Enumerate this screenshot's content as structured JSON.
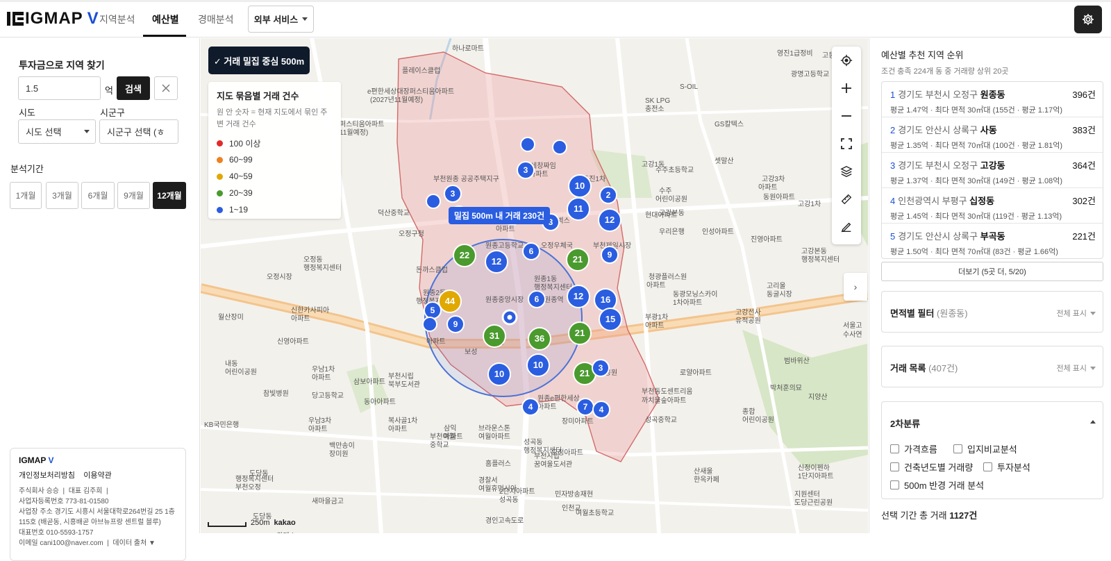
{
  "header": {
    "logo_main": "IGMAP",
    "logo_v": "V",
    "tabs": [
      {
        "label": "지역분석",
        "active": false
      },
      {
        "label": "예산별",
        "active": true
      },
      {
        "label": "경매분석",
        "active": false
      }
    ],
    "external_label": "외부 서비스"
  },
  "left": {
    "search_title": "투자금으로 지역 찾기",
    "amount_value": "1.5",
    "amount_unit": "억",
    "search_button": "검색",
    "clear_icon": "close-icon",
    "sido_label": "시도",
    "sigungu_label": "시군구",
    "sido_select": "시도 선택",
    "sigungu_select": "시군구 선택 (ㅎ",
    "period_label": "분석기간",
    "periods": [
      {
        "label": "1개월",
        "active": false
      },
      {
        "label": "3개월",
        "active": false
      },
      {
        "label": "6개월",
        "active": false
      },
      {
        "label": "9개월",
        "active": false
      },
      {
        "label": "12개월",
        "active": true
      }
    ],
    "footer": {
      "brand": "IGMAP",
      "brand_v": "V",
      "privacy": "개인정보처리방침",
      "terms": "이용약관",
      "company": "주식회사 승승",
      "ceo": "대표 김주희",
      "bizno": "사업자등록번호 773-81-01580",
      "address": "사업장 주소 경기도 시흥시 서울대학로264번길 25 1층 115호 (배곧동, 시흥배곧 아브뉴프랑 센트럴 블루)",
      "phone": "대표번호 010-5593-1757",
      "email": "이메일 cani100@naver.com",
      "data_source": "데이터 출처"
    }
  },
  "map": {
    "chip_label": "✓ 거래 밀집 중심 500m",
    "legend_title": "지도 묶음별 거래 건수",
    "legend_desc": "원 안 숫자 = 현재 지도에서 묶인 주변 거래 건수",
    "legend": [
      {
        "label": "100 이상",
        "color": "#e02b2b"
      },
      {
        "label": "60~99",
        "color": "#f08020"
      },
      {
        "label": "40~59",
        "color": "#e0a800"
      },
      {
        "label": "20~39",
        "color": "#4a9a2e"
      },
      {
        "label": "1~19",
        "color": "#2a5de0"
      }
    ],
    "dense_label": "밀집 500m 내 거래 230건",
    "scale_label": "250m",
    "provider": "kakao",
    "place_labels": [
      "하나로마트",
      "플레이스클럽",
      "e편한세상대장퍼스티움아파트",
      "(2027년11월예정)",
      "퍼스티움아파트",
      "11월예정)",
      "영진1급정비",
      "고등학교",
      "광명고등학교",
      "S-OIL",
      "SK LPG",
      "충전소",
      "GS칼텍스",
      "고강1동",
      "세창짜임",
      "아파트",
      "부천원종 공공주택지구",
      "동진1차",
      "수주",
      "어린이공원",
      "수주초등학교",
      "셋말산",
      "고강3차",
      "아파트",
      "동원아파트",
      "고강1차",
      "고강본동",
      "현대아파트",
      "원종주공",
      "아파트",
      "스타벅스",
      "덕산중학교",
      "오정구청",
      "원종고등학교",
      "오정우체국",
      "오정동",
      "행정복지센터",
      "우리은행",
      "인성아파트",
      "진영아파트",
      "고강본동",
      "행정복지센터",
      "돈까스클럽",
      "오정시장",
      "원종2동",
      "행정복지센터",
      "원종1동",
      "행정복지센터",
      "원종중앙시장",
      "원종역",
      "부천제일시장",
      "청광플러스원",
      "아파트",
      "동광모닝스카이",
      "1차아파트",
      "고리울",
      "동굴시장",
      "신한카사피아",
      "아파트",
      "부광1차",
      "아파트",
      "고강선사",
      "유적공원",
      "서울고",
      "수사연",
      "원종근린공원",
      "신영아파트",
      "범바위산",
      "내동",
      "어린이공원",
      "우남1차",
      "아파트",
      "삼보아파트",
      "부천시립",
      "북부도서관",
      "로얄아파트",
      "참빛병원",
      "부천동도센트리움",
      "까치울숲아파트",
      "지양산",
      "당고등학교",
      "동아아파트",
      "원종e편한세상",
      "아파트",
      "박처훈의묘",
      "종합",
      "어린이공원",
      "성곡중학교",
      "KB국민은행",
      "우남3차",
      "아파트",
      "복사골1차",
      "아파트",
      "장미아파트",
      "부천여월",
      "중학교",
      "브라운스톤",
      "여월아파트",
      "부천시립",
      "꿈여울도서관",
      "오정아파트",
      "성곡동",
      "행정복지센터",
      "백만송이",
      "장미원",
      "홈플러스",
      "산새울",
      "한옥카페",
      "신정이펜하",
      "1단지아파트",
      "인천교",
      "도당동",
      "행정복지센터",
      "부천오정",
      "경찰서",
      "여월휴먼시아",
      "2단지아파트",
      "성곡동",
      "민자방송재현",
      "지원센터",
      "도당근린공원",
      "새마을금고",
      "도당동",
      "GS칼텍스",
      "여월초등학교",
      "경인고속도로",
      "월산장미",
      "아파트",
      "보성",
      "120",
      "삼익",
      "아파트"
    ]
  },
  "right": {
    "title": "예산별 추천 지역 순위",
    "subtitle": "조건 충족 224개 동 중 거래량 상위 20곳",
    "ranks": [
      {
        "num": "1",
        "region": "경기도 부천시 오정구",
        "dong": "원종동",
        "count": "396건",
        "detail": "평균 1.47억 · 최다 면적 30㎡대 (155건 · 평균 1.17억)"
      },
      {
        "num": "2",
        "region": "경기도 안산시 상록구",
        "dong": "사동",
        "count": "383건",
        "detail": "평균 1.35억 · 최다 면적 70㎡대 (100건 · 평균 1.81억)"
      },
      {
        "num": "3",
        "region": "경기도 부천시 오정구",
        "dong": "고강동",
        "count": "364건",
        "detail": "평균 1.37억 · 최다 면적 30㎡대 (149건 · 평균 1.08억)"
      },
      {
        "num": "4",
        "region": "인천광역시 부평구",
        "dong": "십정동",
        "count": "302건",
        "detail": "평균 1.45억 · 최다 면적 30㎡대 (119건 · 평균 1.13억)"
      },
      {
        "num": "5",
        "region": "경기도 안산시 상록구",
        "dong": "부곡동",
        "count": "221건",
        "detail": "평균 1.50억 · 최다 면적 70㎡대 (83건 · 평균 1.66억)"
      }
    ],
    "more_button": "더보기 (5곳 더, 5/20)",
    "area_filter": {
      "title": "면적별 필터",
      "sub": "(원종동)",
      "right": "전체 표시"
    },
    "deal_list": {
      "title": "거래 목록",
      "sub": "(407건)",
      "right": "전체 표시"
    },
    "secondary": {
      "title": "2차분류",
      "options": [
        "가격흐름",
        "입지비교분석",
        "건축년도별 거래량",
        "투자분석",
        "500m 반경 거래 분석"
      ]
    },
    "total_prefix": "선택 기간 총 거래",
    "total_value": "1127건"
  },
  "clusters": [
    {
      "value": "",
      "color": "blue"
    },
    {
      "value": "",
      "color": "blue"
    },
    {
      "value": "3",
      "color": "blue"
    },
    {
      "value": "3",
      "color": "blue"
    },
    {
      "value": "",
      "color": "blue"
    },
    {
      "value": "",
      "color": "blue"
    },
    {
      "value": "10",
      "color": "blue"
    },
    {
      "value": "2",
      "color": "blue"
    },
    {
      "value": "11",
      "color": "blue"
    },
    {
      "value": "12",
      "color": "blue"
    },
    {
      "value": "3",
      "color": "blue"
    },
    {
      "value": "",
      "color": "blue"
    },
    {
      "value": "6",
      "color": "blue"
    },
    {
      "value": "22",
      "color": "green"
    },
    {
      "value": "12",
      "color": "blue"
    },
    {
      "value": "21",
      "color": "green"
    },
    {
      "value": "9",
      "color": "blue"
    },
    {
      "value": "44",
      "color": "yellow"
    },
    {
      "value": "5",
      "color": "blue"
    },
    {
      "value": "",
      "color": "blue"
    },
    {
      "value": "9",
      "color": "blue"
    },
    {
      "value": "6",
      "color": "blue"
    },
    {
      "value": "12",
      "color": "blue"
    },
    {
      "value": "16",
      "color": "blue"
    },
    {
      "value": "15",
      "color": "blue"
    },
    {
      "value": "31",
      "color": "green"
    },
    {
      "value": "36",
      "color": "green"
    },
    {
      "value": "21",
      "color": "green"
    },
    {
      "value": "10",
      "color": "blue"
    },
    {
      "value": "10",
      "color": "blue"
    },
    {
      "value": "21",
      "color": "green"
    },
    {
      "value": "3",
      "color": "blue"
    },
    {
      "value": "4",
      "color": "blue"
    },
    {
      "value": "7",
      "color": "blue"
    },
    {
      "value": "4",
      "color": "blue"
    }
  ]
}
